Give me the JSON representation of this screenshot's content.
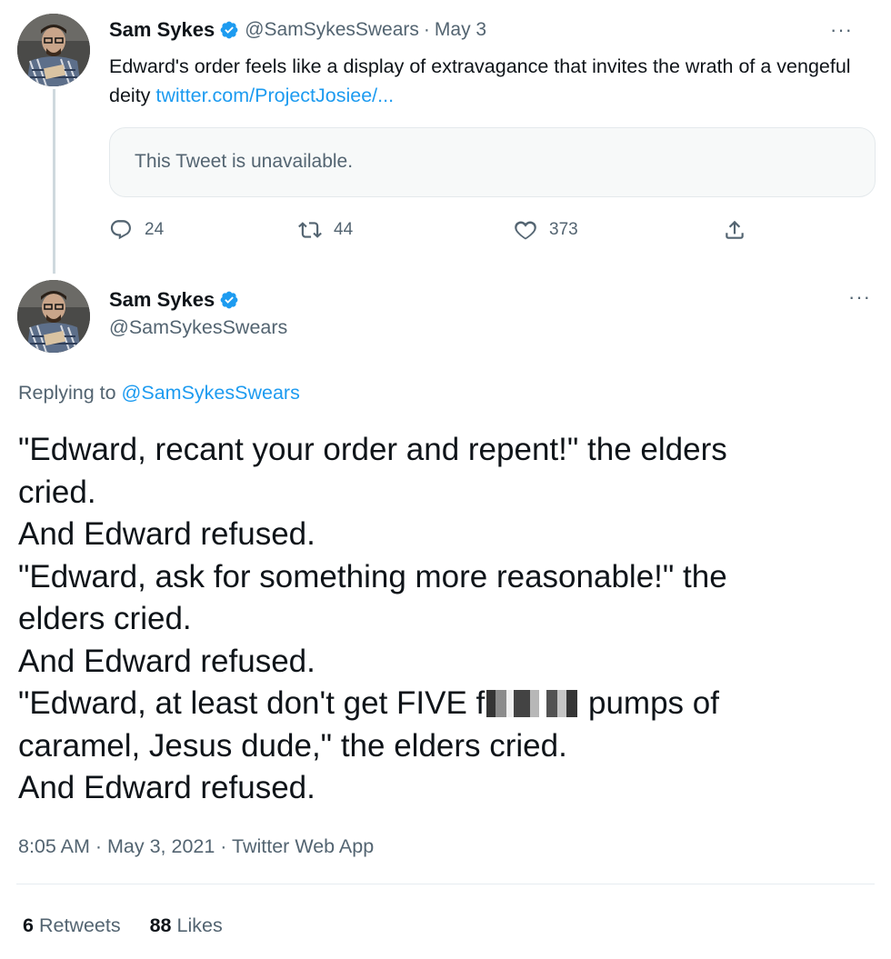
{
  "tweet1": {
    "name": "Sam Sykes",
    "handle": "@SamSykesSwears",
    "separator": "·",
    "date": "May 3",
    "more": "···",
    "text": "Edward's order feels like a display of extravagance that invites the wrath of a vengeful deity ",
    "link": "twitter.com/ProjectJosiee/...",
    "quote_text": "This Tweet is unavailable.",
    "replies": "24",
    "retweets": "44",
    "likes": "373"
  },
  "tweet2": {
    "name": "Sam Sykes",
    "handle": "@SamSykesSwears",
    "more": "···",
    "replying_prefix": "Replying to ",
    "replying_handle": "@SamSykesSwears",
    "lines": [
      "\"Edward, recant your order and repent!\" the elders",
      "cried.",
      "And Edward refused.",
      "\"Edward, ask for something more reasonable!\" the",
      "elders cried.",
      "And Edward refused.",
      "\"Edward, at least don't get FIVE f",
      " pumps of",
      "caramel, Jesus dude,\" the elders cried.",
      "And Edward refused."
    ],
    "meta": "8:05 AM · May 3, 2021 · Twitter Web App",
    "retweets_count": "6",
    "retweets_label": "Retweets",
    "likes_count": "88",
    "likes_label": "Likes"
  },
  "colors": {
    "accent": "#1d9bf0",
    "secondary_text": "#536471",
    "primary_text": "#0f1419",
    "thread_line": "#cfd9de"
  },
  "icons": [
    "verified-badge-icon",
    "more-options-icon",
    "reply-icon",
    "retweet-icon",
    "like-icon",
    "share-icon"
  ]
}
